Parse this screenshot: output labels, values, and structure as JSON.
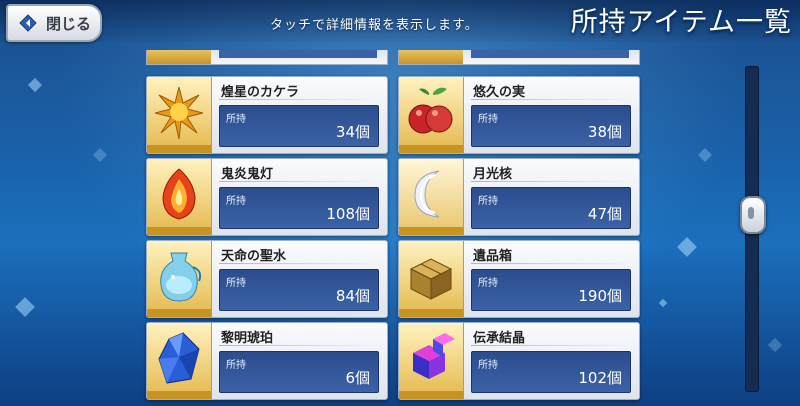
{
  "header": {
    "back_label": "閉じる",
    "hint": "タッチで詳細情報を表示します。",
    "title": "所持アイテム一覧"
  },
  "count_label": "所持",
  "items": [
    {
      "name": "煌星のカケラ",
      "count": "34個",
      "icon": "star-shard-icon"
    },
    {
      "name": "悠久の実",
      "count": "38個",
      "icon": "red-fruit-icon"
    },
    {
      "name": "鬼炎鬼灯",
      "count": "108個",
      "icon": "flame-lantern-icon"
    },
    {
      "name": "月光核",
      "count": "47個",
      "icon": "crescent-moon-icon"
    },
    {
      "name": "天命の聖水",
      "count": "84個",
      "icon": "water-jar-icon"
    },
    {
      "name": "遺品箱",
      "count": "190個",
      "icon": "relic-box-icon"
    },
    {
      "name": "黎明琥珀",
      "count": "6個",
      "icon": "amber-crystal-icon"
    },
    {
      "name": "伝承結晶",
      "count": "102個",
      "icon": "cube-crystal-icon"
    }
  ],
  "colors": {
    "accent": "#3b62a6",
    "card_bg": "#f5f7fa",
    "frame_gold": "#e4b84b"
  }
}
